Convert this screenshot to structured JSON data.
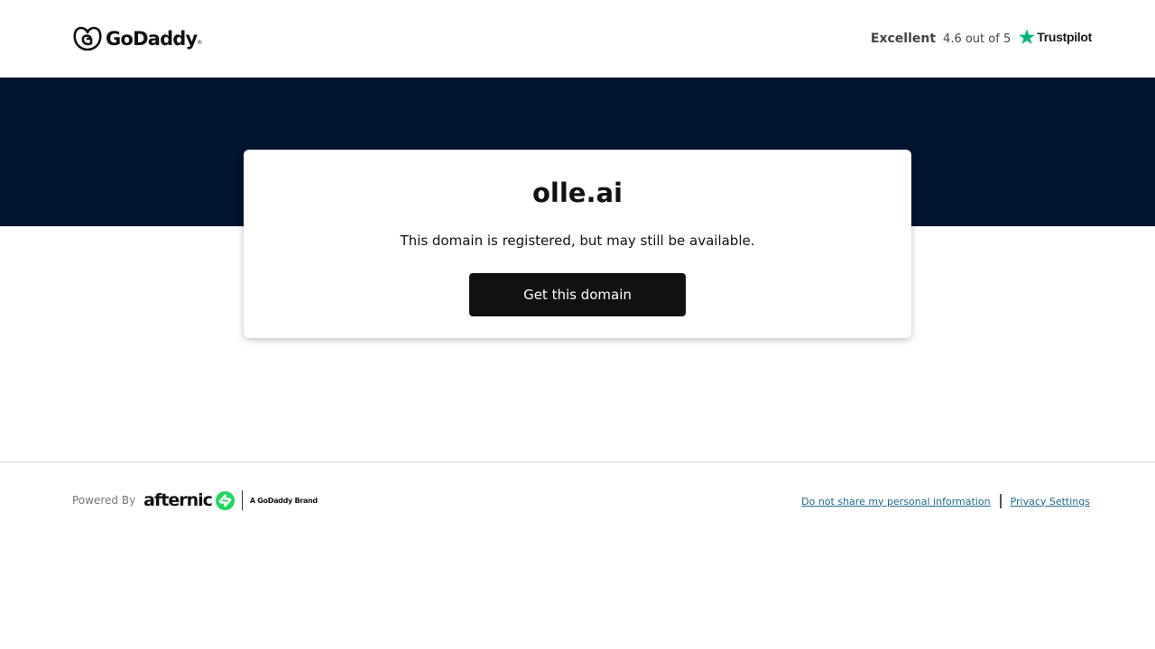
{
  "header": {
    "logo_text": "GoDaddy",
    "logo_tm": "®",
    "rating_word": "Excellent",
    "rating_score": "4.6 out of 5",
    "rating_brand": "Trustpilot"
  },
  "card": {
    "domain": "olle.ai",
    "message": "This domain is registered, but may still be available.",
    "cta_label": "Get this domain"
  },
  "footer": {
    "powered_by": "Powered By",
    "brand_name": "afternic",
    "brand_tag": "A GoDaddy Brand",
    "links": [
      "Do not share my personal information",
      "Privacy Settings"
    ]
  },
  "colors": {
    "hero_bg": "#00142e",
    "cta_bg": "#111111",
    "trustpilot_green": "#00b67a",
    "afternic_green": "#1ed760",
    "link": "#1e6a8d"
  },
  "icons": [
    "godaddy-logo-icon",
    "trustpilot-star-icon",
    "afternic-icon"
  ]
}
